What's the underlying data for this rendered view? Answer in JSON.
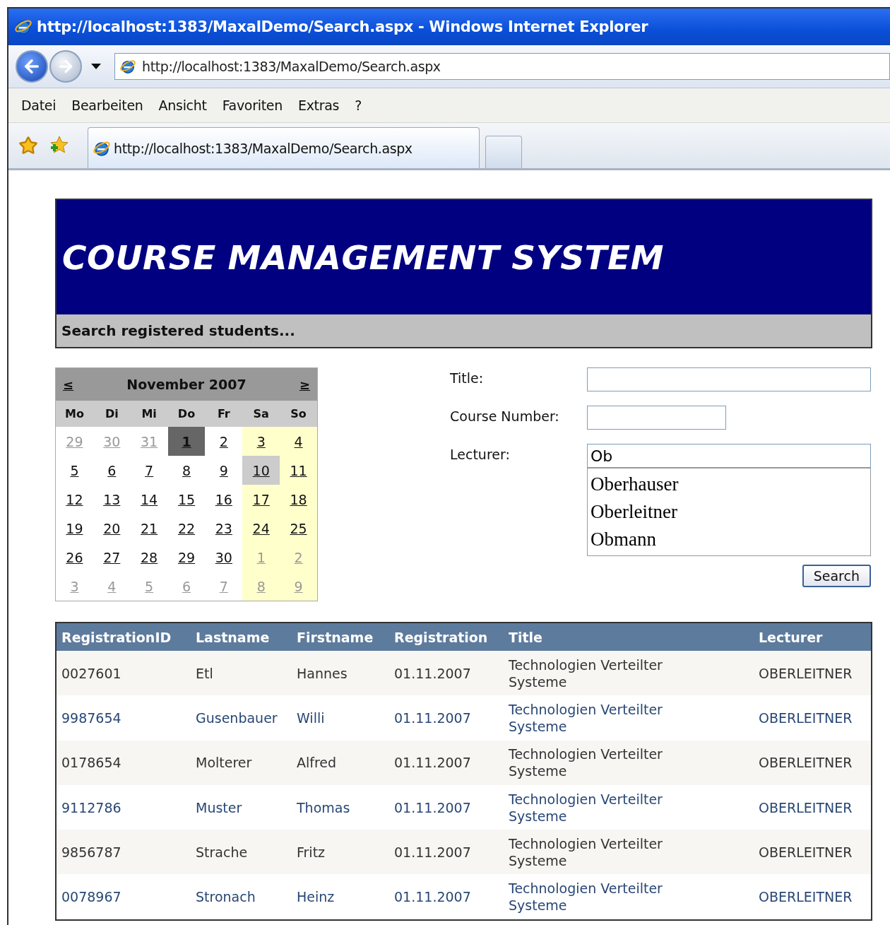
{
  "window": {
    "title": "http://localhost:1383/MaxalDemo/Search.aspx - Windows Internet Explorer"
  },
  "address_bar": {
    "value": "http://localhost:1383/MaxalDemo/Search.aspx"
  },
  "menu": [
    "Datei",
    "Bearbeiten",
    "Ansicht",
    "Favoriten",
    "Extras",
    "?"
  ],
  "tabs": [
    {
      "label": "http://localhost:1383/MaxalDemo/Search.aspx",
      "selected": true
    }
  ],
  "header": {
    "title": "COURSE MANAGEMENT SYSTEM",
    "subtitle": "Search registered students..."
  },
  "calendar": {
    "prev": "≤",
    "month": "November 2007",
    "next": "≥",
    "weekdays": [
      "Mo",
      "Di",
      "Mi",
      "Do",
      "Fr",
      "Sa",
      "So"
    ],
    "weeks": [
      [
        {
          "day": "29",
          "other_month": true,
          "selected": false,
          "today": false
        },
        {
          "day": "30",
          "other_month": true,
          "selected": false,
          "today": false
        },
        {
          "day": "31",
          "other_month": true,
          "selected": false,
          "today": false
        },
        {
          "day": "1",
          "other_month": false,
          "selected": true,
          "today": false
        },
        {
          "day": "2",
          "other_month": false,
          "selected": false,
          "today": false
        },
        {
          "day": "3",
          "other_month": false,
          "selected": false,
          "today": false
        },
        {
          "day": "4",
          "other_month": false,
          "selected": false,
          "today": false
        }
      ],
      [
        {
          "day": "5",
          "other_month": false,
          "selected": false,
          "today": false
        },
        {
          "day": "6",
          "other_month": false,
          "selected": false,
          "today": false
        },
        {
          "day": "7",
          "other_month": false,
          "selected": false,
          "today": false
        },
        {
          "day": "8",
          "other_month": false,
          "selected": false,
          "today": false
        },
        {
          "day": "9",
          "other_month": false,
          "selected": false,
          "today": false
        },
        {
          "day": "10",
          "other_month": false,
          "selected": false,
          "today": true
        },
        {
          "day": "11",
          "other_month": false,
          "selected": false,
          "today": false
        }
      ],
      [
        {
          "day": "12",
          "other_month": false,
          "selected": false,
          "today": false
        },
        {
          "day": "13",
          "other_month": false,
          "selected": false,
          "today": false
        },
        {
          "day": "14",
          "other_month": false,
          "selected": false,
          "today": false
        },
        {
          "day": "15",
          "other_month": false,
          "selected": false,
          "today": false
        },
        {
          "day": "16",
          "other_month": false,
          "selected": false,
          "today": false
        },
        {
          "day": "17",
          "other_month": false,
          "selected": false,
          "today": false
        },
        {
          "day": "18",
          "other_month": false,
          "selected": false,
          "today": false
        }
      ],
      [
        {
          "day": "19",
          "other_month": false,
          "selected": false,
          "today": false
        },
        {
          "day": "20",
          "other_month": false,
          "selected": false,
          "today": false
        },
        {
          "day": "21",
          "other_month": false,
          "selected": false,
          "today": false
        },
        {
          "day": "22",
          "other_month": false,
          "selected": false,
          "today": false
        },
        {
          "day": "23",
          "other_month": false,
          "selected": false,
          "today": false
        },
        {
          "day": "24",
          "other_month": false,
          "selected": false,
          "today": false
        },
        {
          "day": "25",
          "other_month": false,
          "selected": false,
          "today": false
        }
      ],
      [
        {
          "day": "26",
          "other_month": false,
          "selected": false,
          "today": false
        },
        {
          "day": "27",
          "other_month": false,
          "selected": false,
          "today": false
        },
        {
          "day": "28",
          "other_month": false,
          "selected": false,
          "today": false
        },
        {
          "day": "29",
          "other_month": false,
          "selected": false,
          "today": false
        },
        {
          "day": "30",
          "other_month": false,
          "selected": false,
          "today": false
        },
        {
          "day": "1",
          "other_month": true,
          "selected": false,
          "today": false
        },
        {
          "day": "2",
          "other_month": true,
          "selected": false,
          "today": false
        }
      ],
      [
        {
          "day": "3",
          "other_month": true,
          "selected": false,
          "today": false
        },
        {
          "day": "4",
          "other_month": true,
          "selected": false,
          "today": false
        },
        {
          "day": "5",
          "other_month": true,
          "selected": false,
          "today": false
        },
        {
          "day": "6",
          "other_month": true,
          "selected": false,
          "today": false
        },
        {
          "day": "7",
          "other_month": true,
          "selected": false,
          "today": false
        },
        {
          "day": "8",
          "other_month": true,
          "selected": false,
          "today": false
        },
        {
          "day": "9",
          "other_month": true,
          "selected": false,
          "today": false
        }
      ]
    ]
  },
  "form": {
    "fields": [
      {
        "label": "Title:"
      },
      {
        "label": "Course Number:"
      },
      {
        "label": "Lecturer:",
        "value": "Ob"
      }
    ],
    "suggestions": [
      {
        "label": "Oberhauser",
        "selected": false
      },
      {
        "label": "Oberleitner",
        "selected": false
      },
      {
        "label": "Obmann",
        "selected": false
      }
    ],
    "search_button": "Search"
  },
  "table": {
    "columns": [
      "RegistrationID",
      "Lastname",
      "Firstname",
      "Registration",
      "Title",
      "Lecturer"
    ],
    "rows": [
      [
        "0027601",
        "Etl",
        "Hannes",
        "01.11.2007",
        "Technologien Verteilter Systeme",
        "OBERLEITNER"
      ],
      [
        "9987654",
        "Gusenbauer",
        "Willi",
        "01.11.2007",
        "Technologien Verteilter Systeme",
        "OBERLEITNER"
      ],
      [
        "0178654",
        "Molterer",
        "Alfred",
        "01.11.2007",
        "Technologien Verteilter Systeme",
        "OBERLEITNER"
      ],
      [
        "9112786",
        "Muster",
        "Thomas",
        "01.11.2007",
        "Technologien Verteilter Systeme",
        "OBERLEITNER"
      ],
      [
        "9856787",
        "Strache",
        "Fritz",
        "01.11.2007",
        "Technologien Verteilter Systeme",
        "OBERLEITNER"
      ],
      [
        "0078967",
        "Stronach",
        "Heinz",
        "01.11.2007",
        "Technologien Verteilter Systeme",
        "OBERLEITNER"
      ]
    ]
  }
}
